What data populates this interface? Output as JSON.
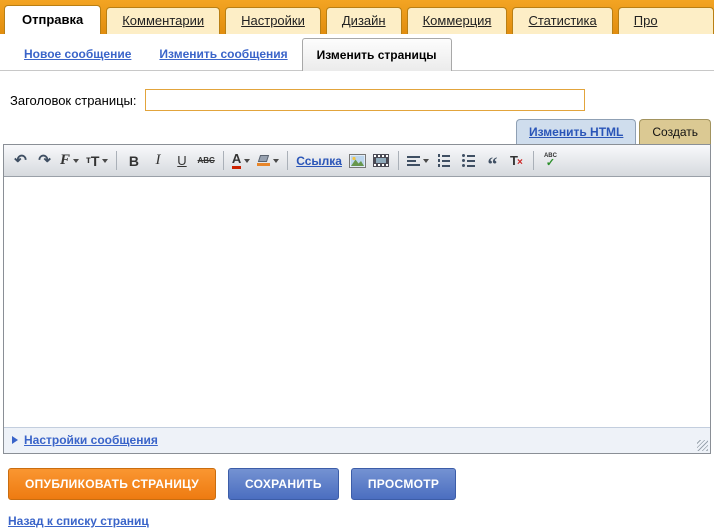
{
  "tabs": [
    {
      "label": "Отправка",
      "active": true
    },
    {
      "label": "Комментарии"
    },
    {
      "label": "Настройки"
    },
    {
      "label": "Дизайн"
    },
    {
      "label": "Коммерция"
    },
    {
      "label": "Статистика"
    },
    {
      "label": "Про"
    }
  ],
  "subnav": [
    {
      "label": "Новое сообщение"
    },
    {
      "label": "Изменить сообщения"
    },
    {
      "label": "Изменить страницы",
      "active": true
    }
  ],
  "form": {
    "title_label": "Заголовок страницы:",
    "title_value": ""
  },
  "editor": {
    "html_tab": "Изменить HTML",
    "compose_tab": "Создать",
    "settings_toggle": "Настройки сообщения"
  },
  "toolbar": {
    "undo": "↶",
    "redo": "↷",
    "font": "F",
    "size_small": "т",
    "size_big": "Т",
    "bold": "B",
    "italic": "I",
    "underline": "U",
    "strike": "ABC",
    "color_letter": "A",
    "link": "Ссылка",
    "quote": "“",
    "clear_t": "T",
    "clear_x": "×",
    "spell_abc": "ABC",
    "spell_check": "✓"
  },
  "actions": {
    "publish": "ОПУБЛИКОВАТЬ СТРАНИЦУ",
    "save": "СОХРАНИТЬ",
    "preview": "ПРОСМОТР"
  },
  "footer": {
    "back_link": "Назад к списку страниц"
  },
  "colors": {
    "tabbar_orange": "#ed9a1c",
    "tab_cream": "#fdeec6",
    "active_tab_white": "#ffffff",
    "link_blue": "#3a64c9",
    "title_input_border": "#e2a43c",
    "html_tab_bg": "#cfdded",
    "compose_tab_bg": "#dbc993",
    "publish_orange": "#ee7b11",
    "save_blue": "#4b6ec0"
  }
}
